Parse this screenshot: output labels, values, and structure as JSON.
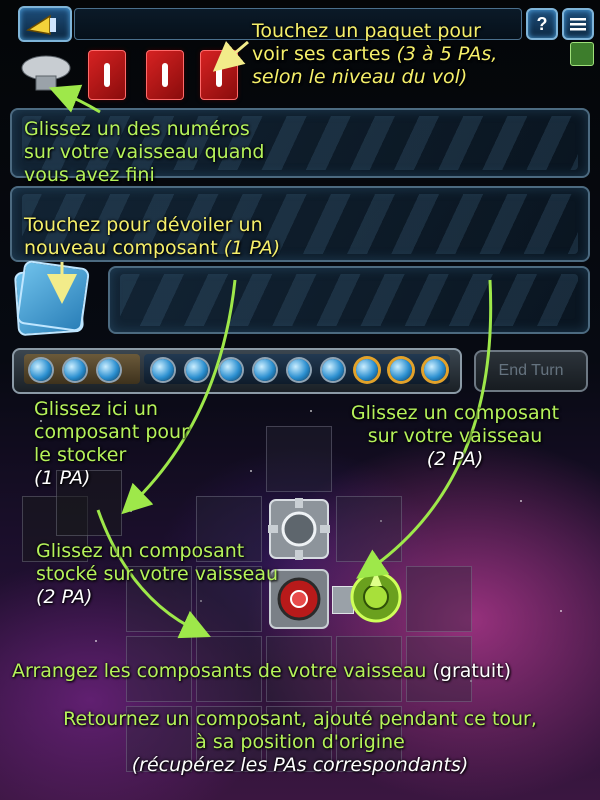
{
  "hud": {
    "help_label": "?",
    "menu_icon": "hamburger-menu-icon",
    "back_icon": "back-arrow-icon",
    "end_turn_label": "End Turn"
  },
  "tips": {
    "packet": {
      "line1": "Touchez un paquet pour",
      "line2a": "voir ses cartes ",
      "line2b": "(3 à 5 PAs,",
      "line3": "selon le niveau du vol)"
    },
    "numbers": {
      "line1": "Glissez un des numéros",
      "line2": "sur votre vaisseau quand",
      "line3": "vous avez fini"
    },
    "reveal": {
      "line1": "Touchez pour dévoiler un",
      "line2a": "nouveau composant ",
      "line2b": "(1 PA)"
    },
    "store": {
      "line1": "Glissez ici un",
      "line2": "composant pour",
      "line3": "le stocker",
      "line4": "(1 PA)"
    },
    "place": {
      "line1": "Glissez un composant",
      "line2": "sur votre vaisseau",
      "line3": "(2 PA)"
    },
    "stored": {
      "line1": "Glissez un composant",
      "line2": "stocké sur votre vaisseau",
      "line3": "(2 PA)"
    },
    "arrange": {
      "main": "Arrangez les composants de votre vaisseau ",
      "note": "(gratuit)"
    },
    "return": {
      "line1": "Retournez un composant, ajouté pendant ce tour,",
      "line2": "à sa position d'origine",
      "line3": "(récupérez les PAs correspondants)"
    }
  },
  "turn_track": {
    "orbs_total": 13,
    "highlighted_orbs": [
      11,
      12,
      13
    ]
  },
  "colors": {
    "tip_text": "#b5f25a",
    "highlight_text": "#f5ef6a",
    "card_red": "#d62222",
    "deck_blue": "#4aa6dc"
  }
}
